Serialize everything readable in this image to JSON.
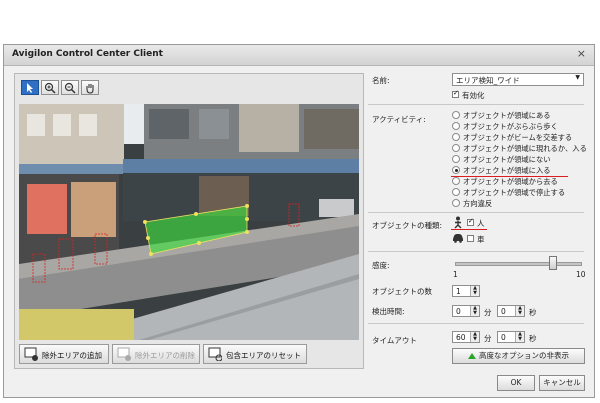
{
  "window": {
    "title": "Avigilon Control Center Client",
    "close": "×"
  },
  "toolbar": {
    "icons": [
      "pointer-icon",
      "zoom-in-icon",
      "zoom-out-icon",
      "pan-hand-icon"
    ]
  },
  "bottom_buttons": [
    {
      "label": "除外エリアの追加",
      "enabled": true
    },
    {
      "label": "除外エリアの削除",
      "enabled": false
    },
    {
      "label": "包含エリアのリセット",
      "enabled": true
    }
  ],
  "name": {
    "label": "名前:",
    "value": "エリア検知_ワイド",
    "enabled_label": "有効化",
    "enabled": true
  },
  "activity": {
    "label": "アクティビティ:",
    "options": [
      "オブジェクトが領域にある",
      "オブジェクトがぶらぶら歩く",
      "オブジェクトがビームを交差する",
      "オブジェクトが領域に現れるか、入る",
      "オブジェクトが領域にない",
      "オブジェクトが領域に入る",
      "オブジェクトが領域から去る",
      "オブジェクトが領域で停止する",
      "方向違反"
    ],
    "selected_index": 5
  },
  "object_types": {
    "label": "オブジェクトの種類:",
    "person": "人",
    "person_checked": true,
    "vehicle": "車",
    "vehicle_checked": false
  },
  "sensitivity": {
    "label": "感度:",
    "min": "1",
    "max": "10",
    "value": 8
  },
  "object_count": {
    "label": "オブジェクトの数",
    "value": "1"
  },
  "detection_time": {
    "label": "検出時間:",
    "min_value": "0",
    "min_unit": "分",
    "sec_value": "0",
    "sec_unit": "秒"
  },
  "timeout": {
    "label": "タイムアウト",
    "min_value": "60",
    "min_unit": "分",
    "sec_value": "0",
    "sec_unit": "秒"
  },
  "advanced_button": "高度なオプションの非表示",
  "ok_button": "OK",
  "cancel_button": "キャンセル",
  "colors": {
    "accent": "#2f70c6",
    "zone": "#3ddc3d",
    "underline": "#d81e1e"
  }
}
